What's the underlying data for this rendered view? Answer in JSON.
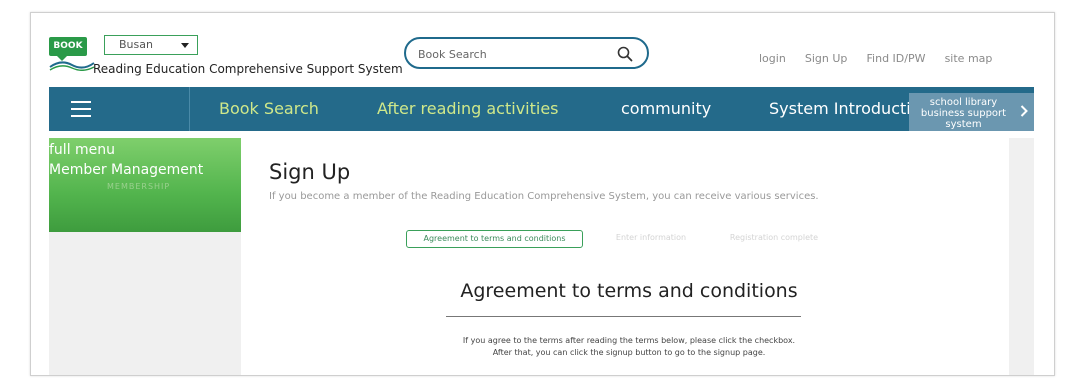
{
  "header": {
    "logo_text": "BOOK",
    "region_select": {
      "value": "Busan"
    },
    "site_name": "Reading Education Comprehensive Support System",
    "search": {
      "placeholder": "Book Search"
    },
    "util_links": [
      "login",
      "Sign Up",
      "Find ID/PW",
      "site map"
    ]
  },
  "nav": {
    "items": [
      "Book Search",
      "After reading activities",
      "community",
      "System Introduction"
    ],
    "side_label_lines": [
      "school library",
      "business support",
      "system"
    ]
  },
  "sidebar": {
    "full_menu": "full menu",
    "title": "Member Management",
    "subtitle": "MEMBERSHIP"
  },
  "main": {
    "title": "Sign Up",
    "description": "If you become a member of the Reading Education Comprehensive System, you can receive various services.",
    "steps": [
      "Agreement to terms and conditions",
      "Enter information",
      "Registration complete"
    ],
    "section_title": "Agreement to terms and conditions",
    "section_desc": [
      "If you agree to the terms after reading the terms below, please click the checkbox.",
      "After that, you can click the signup button to go to the signup page."
    ]
  },
  "colors": {
    "nav_bg": "#246a8a",
    "nav_highlight": "#cfe88a",
    "brand_green": "#3aa05a",
    "search_border": "#1f6a8c"
  },
  "icons": {
    "search": "search-icon",
    "menu": "hamburger-menu-icon",
    "arrow": "chevron-right-icon",
    "dropdown": "caret-down-icon"
  }
}
